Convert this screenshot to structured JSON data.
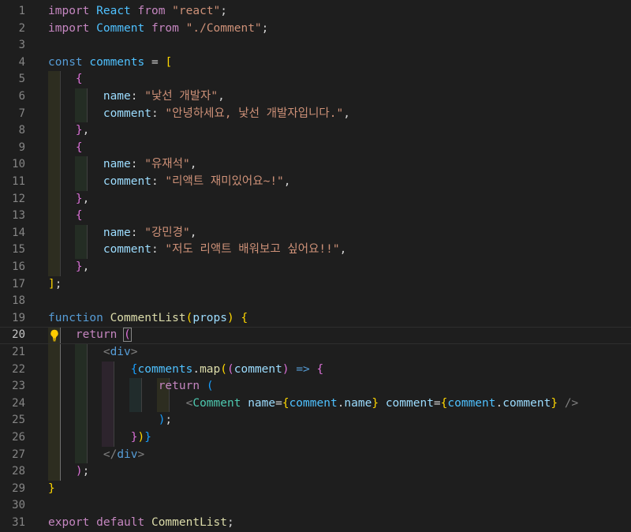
{
  "editor": {
    "current_line": 20,
    "lines": [
      {
        "n": "1",
        "tokens": [
          [
            "kw",
            "import"
          ],
          [
            "punc",
            " "
          ],
          [
            "var",
            "React"
          ],
          [
            "punc",
            " "
          ],
          [
            "kw",
            "from"
          ],
          [
            "punc",
            " "
          ],
          [
            "str",
            "\"react\""
          ],
          [
            "punc",
            ";"
          ]
        ]
      },
      {
        "n": "2",
        "tokens": [
          [
            "kw",
            "import"
          ],
          [
            "punc",
            " "
          ],
          [
            "var",
            "Comment"
          ],
          [
            "punc",
            " "
          ],
          [
            "kw",
            "from"
          ],
          [
            "punc",
            " "
          ],
          [
            "str",
            "\"./Comment\""
          ],
          [
            "punc",
            ";"
          ]
        ]
      },
      {
        "n": "3",
        "tokens": []
      },
      {
        "n": "4",
        "tokens": [
          [
            "kwb",
            "const"
          ],
          [
            "punc",
            " "
          ],
          [
            "var",
            "comments"
          ],
          [
            "punc",
            " = "
          ],
          [
            "b1",
            "["
          ]
        ]
      },
      {
        "n": "5",
        "tokens": [
          [
            "punc",
            "    "
          ],
          [
            "b2",
            "{"
          ]
        ]
      },
      {
        "n": "6",
        "tokens": [
          [
            "punc",
            "        "
          ],
          [
            "prop",
            "name"
          ],
          [
            "punc",
            ": "
          ],
          [
            "str",
            "\"낯선 개발자\""
          ],
          [
            "punc",
            ","
          ]
        ]
      },
      {
        "n": "7",
        "tokens": [
          [
            "punc",
            "        "
          ],
          [
            "prop",
            "comment"
          ],
          [
            "punc",
            ": "
          ],
          [
            "str",
            "\"안녕하세요, 낯선 개발자입니다.\""
          ],
          [
            "punc",
            ","
          ]
        ]
      },
      {
        "n": "8",
        "tokens": [
          [
            "punc",
            "    "
          ],
          [
            "b2",
            "}"
          ],
          [
            "punc",
            ","
          ]
        ]
      },
      {
        "n": "9",
        "tokens": [
          [
            "punc",
            "    "
          ],
          [
            "b2",
            "{"
          ]
        ]
      },
      {
        "n": "10",
        "tokens": [
          [
            "punc",
            "        "
          ],
          [
            "prop",
            "name"
          ],
          [
            "punc",
            ": "
          ],
          [
            "str",
            "\"유재석\""
          ],
          [
            "punc",
            ","
          ]
        ]
      },
      {
        "n": "11",
        "tokens": [
          [
            "punc",
            "        "
          ],
          [
            "prop",
            "comment"
          ],
          [
            "punc",
            ": "
          ],
          [
            "str",
            "\"리액트 재미있어요~!\""
          ],
          [
            "punc",
            ","
          ]
        ]
      },
      {
        "n": "12",
        "tokens": [
          [
            "punc",
            "    "
          ],
          [
            "b2",
            "}"
          ],
          [
            "punc",
            ","
          ]
        ]
      },
      {
        "n": "13",
        "tokens": [
          [
            "punc",
            "    "
          ],
          [
            "b2",
            "{"
          ]
        ]
      },
      {
        "n": "14",
        "tokens": [
          [
            "punc",
            "        "
          ],
          [
            "prop",
            "name"
          ],
          [
            "punc",
            ": "
          ],
          [
            "str",
            "\"강민경\""
          ],
          [
            "punc",
            ","
          ]
        ]
      },
      {
        "n": "15",
        "tokens": [
          [
            "punc",
            "        "
          ],
          [
            "prop",
            "comment"
          ],
          [
            "punc",
            ": "
          ],
          [
            "str",
            "\"저도 리액트 배워보고 싶어요!!\""
          ],
          [
            "punc",
            ","
          ]
        ]
      },
      {
        "n": "16",
        "tokens": [
          [
            "punc",
            "    "
          ],
          [
            "b2",
            "}"
          ],
          [
            "punc",
            ","
          ]
        ]
      },
      {
        "n": "17",
        "tokens": [
          [
            "b1",
            "]"
          ],
          [
            "punc",
            ";"
          ]
        ]
      },
      {
        "n": "18",
        "tokens": []
      },
      {
        "n": "19",
        "tokens": [
          [
            "kwb",
            "function"
          ],
          [
            "punc",
            " "
          ],
          [
            "fn",
            "CommentList"
          ],
          [
            "b1",
            "("
          ],
          [
            "prop",
            "props"
          ],
          [
            "b1",
            ")"
          ],
          [
            "punc",
            " "
          ],
          [
            "b1",
            "{"
          ]
        ]
      },
      {
        "n": "20",
        "tokens": [
          [
            "punc",
            "    "
          ],
          [
            "kw",
            "return"
          ],
          [
            "punc",
            " "
          ],
          [
            "b2",
            "("
          ]
        ]
      },
      {
        "n": "21",
        "tokens": [
          [
            "punc",
            "        "
          ],
          [
            "tag",
            "<"
          ],
          [
            "tagname",
            "div"
          ],
          [
            "tag",
            ">"
          ]
        ]
      },
      {
        "n": "22",
        "tokens": [
          [
            "punc",
            "            "
          ],
          [
            "b3",
            "{"
          ],
          [
            "var",
            "comments"
          ],
          [
            "punc",
            "."
          ],
          [
            "fn",
            "map"
          ],
          [
            "b1",
            "("
          ],
          [
            "b2",
            "("
          ],
          [
            "prop",
            "comment"
          ],
          [
            "b2",
            ")"
          ],
          [
            "punc",
            " "
          ],
          [
            "kwb",
            "=>"
          ],
          [
            "punc",
            " "
          ],
          [
            "b2",
            "{"
          ]
        ]
      },
      {
        "n": "23",
        "tokens": [
          [
            "punc",
            "                "
          ],
          [
            "kw",
            "return"
          ],
          [
            "punc",
            " "
          ],
          [
            "b3",
            "("
          ]
        ]
      },
      {
        "n": "24",
        "tokens": [
          [
            "punc",
            "                    "
          ],
          [
            "tag",
            "<"
          ],
          [
            "comp",
            "Comment"
          ],
          [
            "punc",
            " "
          ],
          [
            "prop",
            "name"
          ],
          [
            "punc",
            "="
          ],
          [
            "b1",
            "{"
          ],
          [
            "var",
            "comment"
          ],
          [
            "punc",
            "."
          ],
          [
            "prop",
            "name"
          ],
          [
            "b1",
            "}"
          ],
          [
            "punc",
            " "
          ],
          [
            "prop",
            "comment"
          ],
          [
            "punc",
            "="
          ],
          [
            "b1",
            "{"
          ],
          [
            "var",
            "comment"
          ],
          [
            "punc",
            "."
          ],
          [
            "prop",
            "comment"
          ],
          [
            "b1",
            "}"
          ],
          [
            "punc",
            " "
          ],
          [
            "tag",
            "/>"
          ]
        ]
      },
      {
        "n": "25",
        "tokens": [
          [
            "punc",
            "                "
          ],
          [
            "b3",
            ")"
          ],
          [
            "punc",
            ";"
          ]
        ]
      },
      {
        "n": "26",
        "tokens": [
          [
            "punc",
            "            "
          ],
          [
            "b2",
            "}"
          ],
          [
            "b1",
            ")"
          ],
          [
            "b3",
            "}"
          ]
        ]
      },
      {
        "n": "27",
        "tokens": [
          [
            "punc",
            "        "
          ],
          [
            "tag",
            "</"
          ],
          [
            "tagname",
            "div"
          ],
          [
            "tag",
            ">"
          ]
        ]
      },
      {
        "n": "28",
        "tokens": [
          [
            "punc",
            "    "
          ],
          [
            "b2",
            ")"
          ],
          [
            "punc",
            ";"
          ]
        ]
      },
      {
        "n": "29",
        "tokens": [
          [
            "b1",
            "}"
          ]
        ]
      },
      {
        "n": "30",
        "tokens": []
      },
      {
        "n": "31",
        "tokens": [
          [
            "kw",
            "export"
          ],
          [
            "punc",
            " "
          ],
          [
            "kw",
            "default"
          ],
          [
            "punc",
            " "
          ],
          [
            "fn",
            "CommentList"
          ],
          [
            "punc",
            ";"
          ]
        ]
      }
    ]
  },
  "colors": {
    "background": "#1e1e1e",
    "line_number": "#858585",
    "keyword_control": "#c586c0",
    "keyword_storage": "#569cd6",
    "variable": "#4fc1ff",
    "property": "#9cdcfe",
    "string": "#ce9178",
    "function": "#dcdcaa",
    "component": "#4ec9b0",
    "bracket_1": "#ffd700",
    "bracket_2": "#da70d6",
    "bracket_3": "#179fff"
  },
  "icons": {
    "lightbulb": "lightbulb-icon"
  }
}
